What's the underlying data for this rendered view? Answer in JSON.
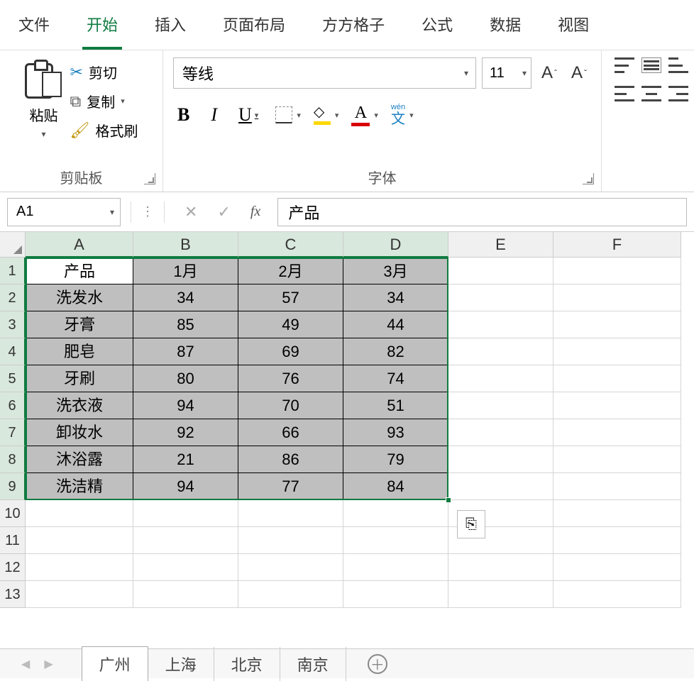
{
  "menu": {
    "items": [
      "文件",
      "开始",
      "插入",
      "页面布局",
      "方方格子",
      "公式",
      "数据",
      "视图"
    ],
    "active_index": 1
  },
  "ribbon": {
    "clipboard": {
      "paste": "粘贴",
      "cut": "剪切",
      "copy": "复制",
      "format_painter": "格式刷",
      "group_label": "剪贴板"
    },
    "font": {
      "font_name": "等线",
      "font_size": "11",
      "group_label": "字体",
      "bold": "B",
      "italic": "I",
      "underline": "U",
      "color_letter": "A",
      "wen_top": "wén",
      "wen_main": "文"
    },
    "increase_A": "A",
    "decrease_A": "A"
  },
  "formula_bar": {
    "name_box": "A1",
    "fx_label": "fx",
    "formula_value": "产品"
  },
  "grid": {
    "columns": [
      "A",
      "B",
      "C",
      "D",
      "E",
      "F"
    ],
    "row_numbers": [
      "1",
      "2",
      "3",
      "4",
      "5",
      "6",
      "7",
      "8",
      "9",
      "10",
      "11",
      "12",
      "13"
    ],
    "headers": [
      "产品",
      "1月",
      "2月",
      "3月"
    ],
    "rows": [
      [
        "洗发水",
        "34",
        "57",
        "34"
      ],
      [
        "牙膏",
        "85",
        "49",
        "44"
      ],
      [
        "肥皂",
        "87",
        "69",
        "82"
      ],
      [
        "牙刷",
        "80",
        "76",
        "74"
      ],
      [
        "洗衣液",
        "94",
        "70",
        "51"
      ],
      [
        "卸妆水",
        "92",
        "66",
        "93"
      ],
      [
        "沐浴露",
        "21",
        "86",
        "79"
      ],
      [
        "洗洁精",
        "94",
        "77",
        "84"
      ]
    ]
  },
  "sheets": {
    "tabs": [
      "广州",
      "上海",
      "北京",
      "南京"
    ],
    "active_index": 0
  },
  "icons": {
    "quick_analysis": "⎘"
  }
}
